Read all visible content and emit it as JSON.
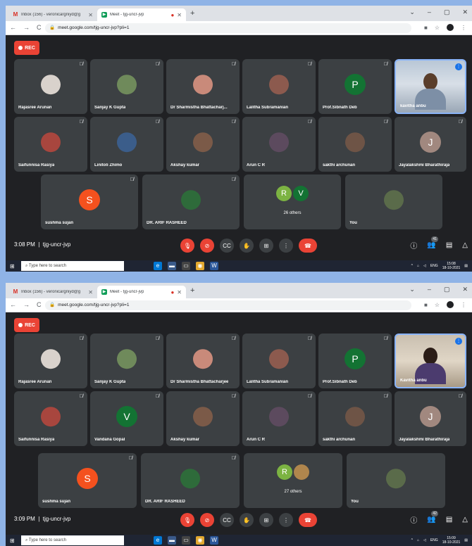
{
  "browser": {
    "tab1_title": "Inbox (156) - veronicargniyd@g",
    "tab2_title": "Meet - tjg-uncr-jvp",
    "url_shot1": "meet.google.com/tjg-uncr-jvp?pli=1",
    "url_shot2": "meet.google.com/tjg-uncr-jvp?pli=1"
  },
  "rec_label": "REC",
  "shot1": {
    "tiles": [
      {
        "name": "Rajasree Arunan"
      },
      {
        "name": "Sanjay K Gupta"
      },
      {
        "name": "Dr Sharmistha Bhattacharj..."
      },
      {
        "name": "Lalitha Subramanian"
      },
      {
        "name": "Prof.Sibnath Deb",
        "letter": "P"
      },
      {
        "name": "kavitha anbu"
      },
      {
        "name": "Saifunnisa Rasiya"
      },
      {
        "name": "Linitoli Zhimo"
      },
      {
        "name": "Akshay kumar"
      },
      {
        "name": "Arun C R"
      },
      {
        "name": "sakthi archunan"
      },
      {
        "name": "Jayalakshmi Bharathiraja",
        "letter": "J"
      },
      {
        "name": "sushma sujan",
        "letter": "S"
      },
      {
        "name": "DR. ARIF RASHEED"
      },
      {
        "name": "26 others",
        "letters": [
          "R",
          "V"
        ]
      },
      {
        "name": "You"
      }
    ],
    "time": "3:08 PM",
    "meeting_code": "tjg-uncr-jvp",
    "people_count": "41",
    "taskbar_time": "15:08",
    "taskbar_date": "18-10-2021"
  },
  "shot2": {
    "tiles": [
      {
        "name": "Rajasree Arunan"
      },
      {
        "name": "Sanjay K Gupta"
      },
      {
        "name": "Dr Sharmistha Bhattacharjee"
      },
      {
        "name": "Lalitha Subramanian"
      },
      {
        "name": "Prof.Sibnath Deb",
        "letter": "P"
      },
      {
        "name": "Kavitha anbu"
      },
      {
        "name": "Saifunnisa Rasiya"
      },
      {
        "name": "Vandana Gopal",
        "letter": "V"
      },
      {
        "name": "Akshay kumar"
      },
      {
        "name": "Arun C R"
      },
      {
        "name": "sakthi archunan"
      },
      {
        "name": "Jayalakshmi Bharathiraja",
        "letter": "J"
      },
      {
        "name": "sushma sujan",
        "letter": "S"
      },
      {
        "name": "DR. ARIF RASHEED"
      },
      {
        "name": "27 others",
        "letters": [
          "R"
        ]
      },
      {
        "name": "You"
      }
    ],
    "time": "3:09 PM",
    "meeting_code": "tjg-uncr-jvp",
    "people_count": "42",
    "taskbar_time": "15:09",
    "taskbar_date": "18-10-2021"
  },
  "taskbar": {
    "search_placeholder": "Type here to search",
    "lang": "ENG"
  },
  "colors": {
    "meet_bg": "#202124",
    "tile_bg": "#3c4043",
    "red": "#ea4335",
    "green_letter": "#137333",
    "orange_letter": "#f4511e",
    "brown_letter": "#a1887f"
  }
}
